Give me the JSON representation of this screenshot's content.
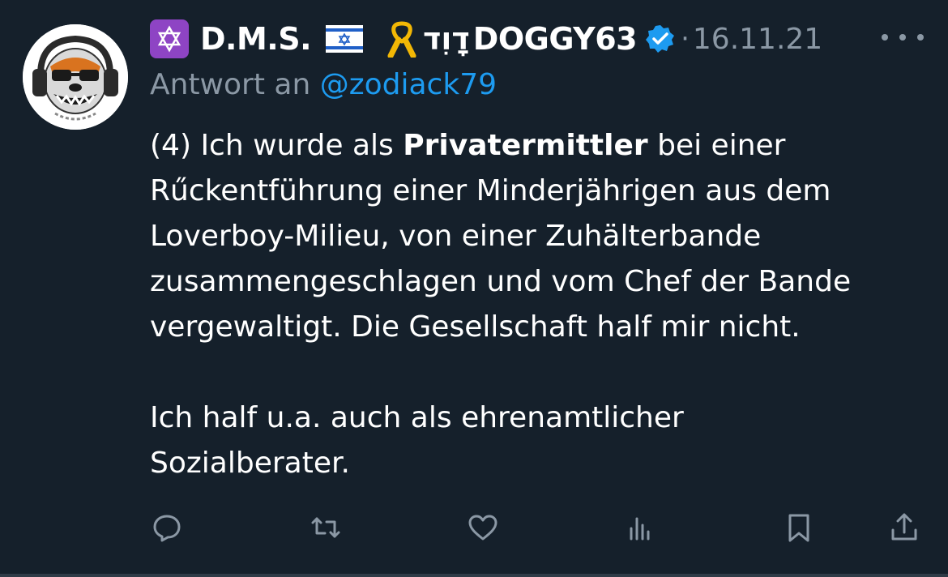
{
  "tweet": {
    "display_name": "D.M.S.",
    "hebrew_name": "דָוִד",
    "handle_name": "DOGGY63",
    "separator": "·",
    "date": "16.11.21",
    "reply_prefix": "Antwort an",
    "reply_mention": "@zodiack79",
    "body": {
      "line1_prefix": "(4) Ich wurde als ",
      "line1_bold": "Privatermittler",
      "line1_suffix": " bei einer",
      "line2": "Rűckentführung einer Minderjährigen aus dem",
      "line3": "Loverboy-Milieu, von einer Zuhälterbande",
      "line4": "zusammengeschlagen und vom Chef der Bande",
      "line5": "vergewaltigt. Die Gesellschaft half mir nicht.",
      "line6": "Ich half u.a. auch als ehrenamtlicher",
      "line7": "Sozialberater."
    },
    "icons": {
      "badge": "star-of-david-icon",
      "flag": "israel-flag-icon",
      "ribbon": "yellow-ribbon-icon",
      "verified": "verified-badge-icon",
      "more": "more-icon",
      "actions": [
        "reply-icon",
        "retweet-icon",
        "like-icon",
        "views-icon",
        "bookmark-icon",
        "share-icon"
      ]
    },
    "colors": {
      "background": "#15202b",
      "text": "#ffffff",
      "secondary": "#8b98a5",
      "link": "#1d9bf0",
      "badge": "#8e44c4",
      "ribbon": "#f2b705"
    }
  }
}
